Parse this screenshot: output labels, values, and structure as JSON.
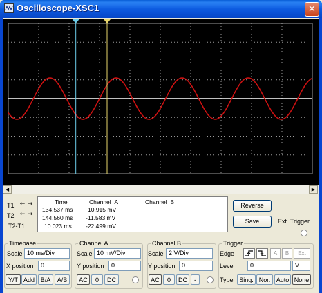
{
  "window": {
    "title": "Oscilloscope-XSC1",
    "close_symbol": "✕"
  },
  "icons": {
    "app": "oscilloscope-icon",
    "close": "close-icon"
  },
  "colors": {
    "title_bar": "#0a5fd8",
    "screen_bg": "#000000",
    "grid": "#9a9a9a",
    "trace_a": "#cc1111",
    "trace_b": "#ffffff",
    "cursor_1": "#6ccce8",
    "cursor_2": "#e8d66c"
  },
  "trace": {
    "channel_a_cycles_visible": 4.6,
    "channel_a_phase_start": 0.62,
    "cursor_1_time_fraction": 0.222,
    "cursor_2_time_fraction": 0.325,
    "cursor_1_marker": "1",
    "cursor_2_marker": "2"
  },
  "readout": {
    "headers": {
      "time": "Time",
      "channel_a": "Channel_A",
      "channel_b": "Channel_B"
    },
    "rows": [
      {
        "label": "T1",
        "time": "134.537 ms",
        "channel_a": "10.915 mV",
        "channel_b": ""
      },
      {
        "label": "T2",
        "time": "144.560 ms",
        "channel_a": "-11.583 mV",
        "channel_b": ""
      },
      {
        "label": "T2-T1",
        "time": "10.023 ms",
        "channel_a": "-22.499 mV",
        "channel_b": ""
      }
    ],
    "arrow_left": "←",
    "arrow_right": "→"
  },
  "buttons": {
    "reverse": "Reverse",
    "save": "Save",
    "ext_trigger": "Ext. Trigger"
  },
  "timebase": {
    "title": "Timebase",
    "scale_label": "Scale",
    "scale_value": "10 ms/Div",
    "xpos_label": "X position",
    "xpos_value": "0",
    "modes": [
      "Y/T",
      "Add",
      "B/A",
      "A/B"
    ]
  },
  "channel_a": {
    "title": "Channel A",
    "scale_label": "Scale",
    "scale_value": "10 mV/Div",
    "ypos_label": "Y position",
    "ypos_value": "0",
    "coupling": [
      "AC",
      "0",
      "DC"
    ]
  },
  "channel_b": {
    "title": "Channel B",
    "scale_label": "Scale",
    "scale_value": "2  V/Div",
    "ypos_label": "Y position",
    "ypos_value": "0",
    "coupling": [
      "AC",
      "0",
      "DC",
      "-"
    ]
  },
  "trigger": {
    "title": "Trigger",
    "edge_label": "Edge",
    "edge_buttons": [
      "⎍",
      "⎍",
      "A",
      "B",
      "Ext"
    ],
    "level_label": "Level",
    "level_value": "0",
    "level_unit": "V",
    "type_label": "Type",
    "types": [
      "Sing.",
      "Nor.",
      "Auto",
      "None"
    ]
  }
}
